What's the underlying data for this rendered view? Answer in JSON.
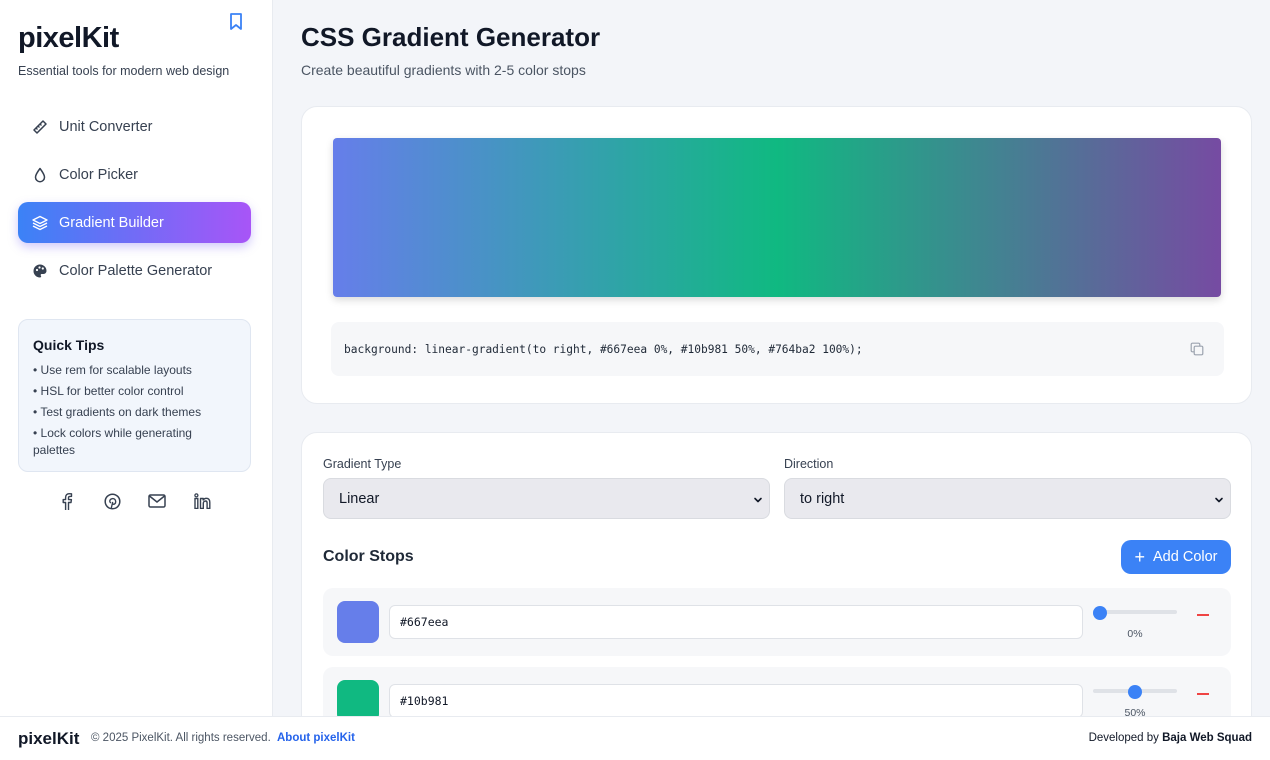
{
  "sidebar": {
    "brand": "pixelKit",
    "tagline": "Essential tools for modern web design",
    "items": [
      {
        "label": "Unit Converter",
        "icon": "ruler-icon"
      },
      {
        "label": "Color Picker",
        "icon": "droplet-icon"
      },
      {
        "label": "Gradient Builder",
        "icon": "layers-icon",
        "active": true
      },
      {
        "label": "Color Palette Generator",
        "icon": "palette-icon"
      }
    ],
    "tips": {
      "title": "Quick Tips",
      "items": [
        "• Use rem for scalable layouts",
        "• HSL for better color control",
        "• Test gradients on dark themes",
        "• Lock colors while generating palettes"
      ]
    },
    "social": [
      "facebook-icon",
      "pinterest-icon",
      "mail-icon",
      "linkedin-icon"
    ]
  },
  "main": {
    "title": "CSS Gradient Generator",
    "subtitle": "Create beautiful gradients with 2-5 color stops",
    "css_output": "background: linear-gradient(to right, #667eea 0%, #10b981 50%, #764ba2 100%);",
    "gradient_type_label": "Gradient Type",
    "gradient_type_value": "Linear",
    "direction_label": "Direction",
    "direction_value": "to right",
    "stops_title": "Color Stops",
    "add_color_label": "Add Color",
    "stops": [
      {
        "hex": "#667eea",
        "position": 0,
        "position_label": "0%"
      },
      {
        "hex": "#10b981",
        "position": 50,
        "position_label": "50%"
      }
    ]
  },
  "colors": {
    "accent": "#3b82f6",
    "accent_purple": "#a855f7",
    "stop_1": "#667eea",
    "stop_2": "#10b981",
    "stop_3": "#764ba2"
  },
  "footer": {
    "brand": "pixelKit",
    "copyright": "© 2025 PixelKit. All rights reserved.",
    "about": "About pixelKit",
    "developed_prefix": "Developed by",
    "developer": "Baja Web Squad"
  }
}
